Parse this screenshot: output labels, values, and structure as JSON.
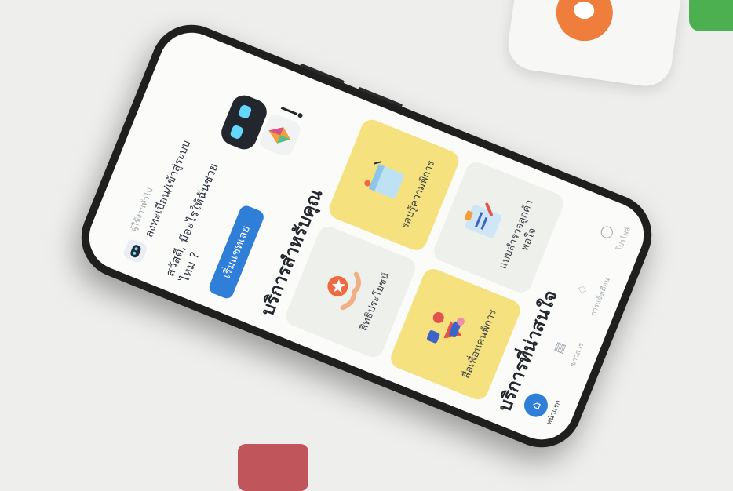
{
  "header": {
    "guest_label": "ผู้ใช้งานทั่วไป",
    "login_link": "ลงทะเบียน/เข้าสู่ระบบ"
  },
  "greeting": {
    "text": "สวัสดี, มีอะไรให้ฉันช่วยไหม ?",
    "button": "เริ่มแชทเลย"
  },
  "services": {
    "title": "บริการสำหรับคุณ",
    "tiles": [
      {
        "label": "สิทธิประโยชน์",
        "icon": "benefits-icon",
        "bg": "#eef0ec"
      },
      {
        "label": "รอบรู้ความพิการ",
        "icon": "document-icon",
        "bg": "#f5e27f"
      },
      {
        "label": "สื่อเพื่อนคนพิการ",
        "icon": "media-icon",
        "bg": "#f5e27f"
      },
      {
        "label": "แบบสำรวจลูกค้าพอใจ",
        "icon": "survey-icon",
        "bg": "#eef0ec"
      }
    ]
  },
  "featured": {
    "title": "บริการที่น่าสนใจ"
  },
  "nav": [
    {
      "label": "หน้าแรก",
      "icon": "home-icon",
      "active": true
    },
    {
      "label": "ข่าวสาร",
      "icon": "news-icon",
      "active": false
    },
    {
      "label": "การแจ้งเตือน",
      "icon": "bell-icon",
      "active": false
    },
    {
      "label": "โปรไฟล์",
      "icon": "user-icon",
      "active": false
    }
  ],
  "colors": {
    "accent": "#2f7fd8",
    "tile_yellow": "#f5e27f",
    "tile_gray": "#eef0ec"
  }
}
